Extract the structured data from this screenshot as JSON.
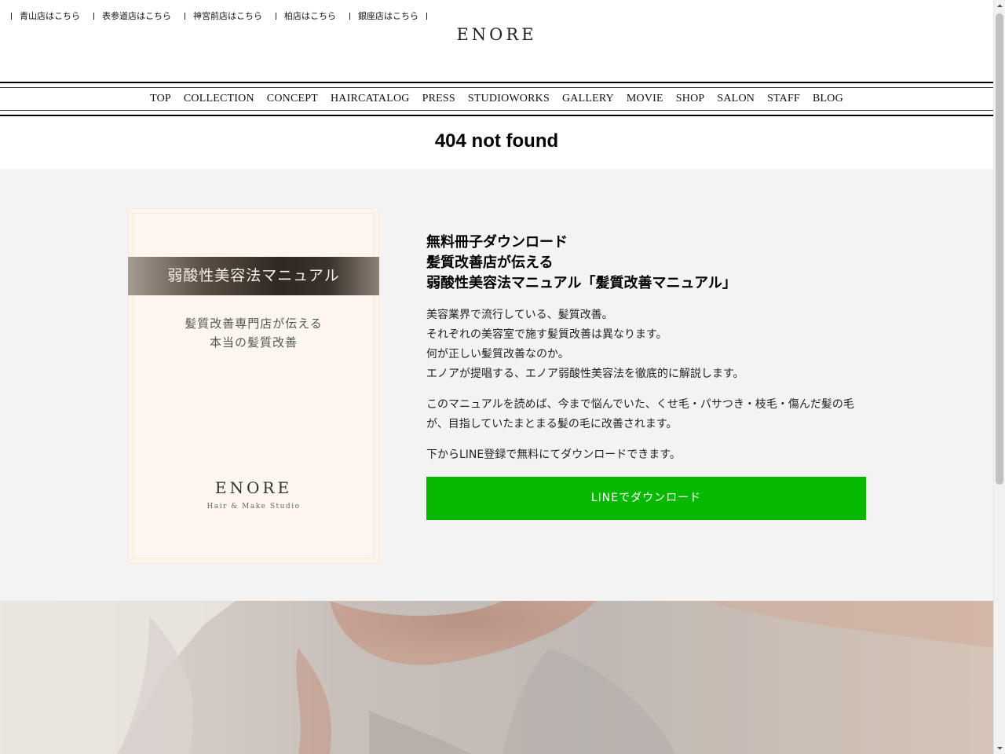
{
  "store_links": [
    {
      "label": "青山店はこちら"
    },
    {
      "label": "表参道店はこちら"
    },
    {
      "label": "神宮前店はこちら"
    },
    {
      "label": "柏店はこちら"
    },
    {
      "label": "銀座店はこちら"
    }
  ],
  "brand": {
    "logo": "ENORE"
  },
  "nav": {
    "items": [
      {
        "label": "TOP"
      },
      {
        "label": "COLLECTION"
      },
      {
        "label": "CONCEPT"
      },
      {
        "label": "HAIRCATALOG"
      },
      {
        "label": "PRESS"
      },
      {
        "label": "STUDIOWORKS"
      },
      {
        "label": "GALLERY"
      },
      {
        "label": "MOVIE"
      },
      {
        "label": "SHOP"
      },
      {
        "label": "SALON"
      },
      {
        "label": "STAFF"
      },
      {
        "label": "BLOG"
      }
    ]
  },
  "page": {
    "title": "404 not found"
  },
  "promo": {
    "book": {
      "band_title": "弱酸性美容法マニュアル",
      "subtitle_line1": "髪質改善専門店が伝える",
      "subtitle_line2": "本当の髪質改善",
      "logo": "ENORE",
      "tagline": "Hair & Make Studio"
    },
    "heading_line1": "無料冊子ダウンロード",
    "heading_line2": "髪質改善店が伝える",
    "heading_line3": "弱酸性美容法マニュアル「髪質改善マニュアル」",
    "para1": [
      "美容業界で流行している、髪質改善。",
      "それぞれの美容室で施す髪質改善は異なります。",
      "何が正しい髪質改善なのか。",
      "エノアが提唱する、エノア弱酸性美容法を徹底的に解説します。"
    ],
    "para2_line1": "このマニュアルを読めば、今まで悩んでいた、くせ毛・パサつき・枝毛・傷んだ髪の毛",
    "para2_line2": "が、目指していたまとまる髪の毛に改善されます。",
    "para3": "下からLINE登録で無料にてダウンロードできます。",
    "cta_label": "LINEでダウンロード",
    "cta_color": "#06b800"
  },
  "colors": {
    "promo_bg": "#f3f3f3",
    "book_bg": "#fcf6ee"
  }
}
